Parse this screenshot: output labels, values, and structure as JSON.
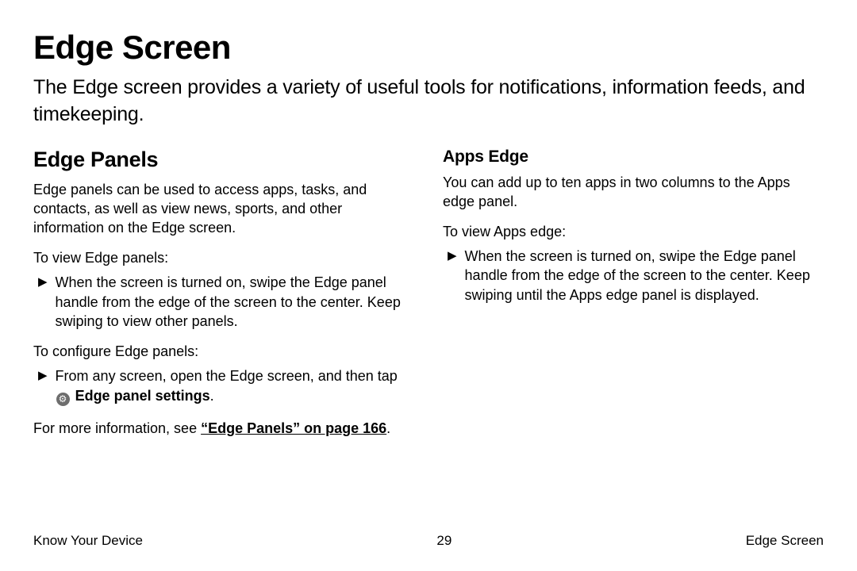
{
  "title": "Edge Screen",
  "intro": "The Edge screen provides a variety of useful tools for notifications, information feeds, and timekeeping.",
  "left": {
    "heading": "Edge Panels",
    "desc": "Edge panels can be used to access apps, tasks, and contacts, as well as view news, sports, and other information on the Edge screen.",
    "view_lead": "To view Edge panels:",
    "view_step": "When the screen is turned on, swipe the Edge panel handle from the edge of the screen to the center. Keep swiping to view other panels.",
    "config_lead": "To configure Edge panels:",
    "config_step_pre": "From any screen, open the Edge screen, and then tap ",
    "config_step_bold": "Edge panel settings",
    "config_step_post": ".",
    "more_pre": "For more information, see ",
    "more_link": "“Edge Panels” on page 166",
    "more_post": "."
  },
  "right": {
    "heading": "Apps Edge",
    "desc": "You can add up to ten apps in two columns to the Apps edge panel.",
    "view_lead": "To view Apps edge:",
    "view_step": "When the screen is turned on, swipe the Edge panel handle from the edge of the screen to the center. Keep swiping until the Apps edge panel is displayed."
  },
  "footer": {
    "left": "Know Your Device",
    "center": "29",
    "right": "Edge Screen"
  },
  "glyphs": {
    "arrow": "▶",
    "gear": "⚙"
  }
}
